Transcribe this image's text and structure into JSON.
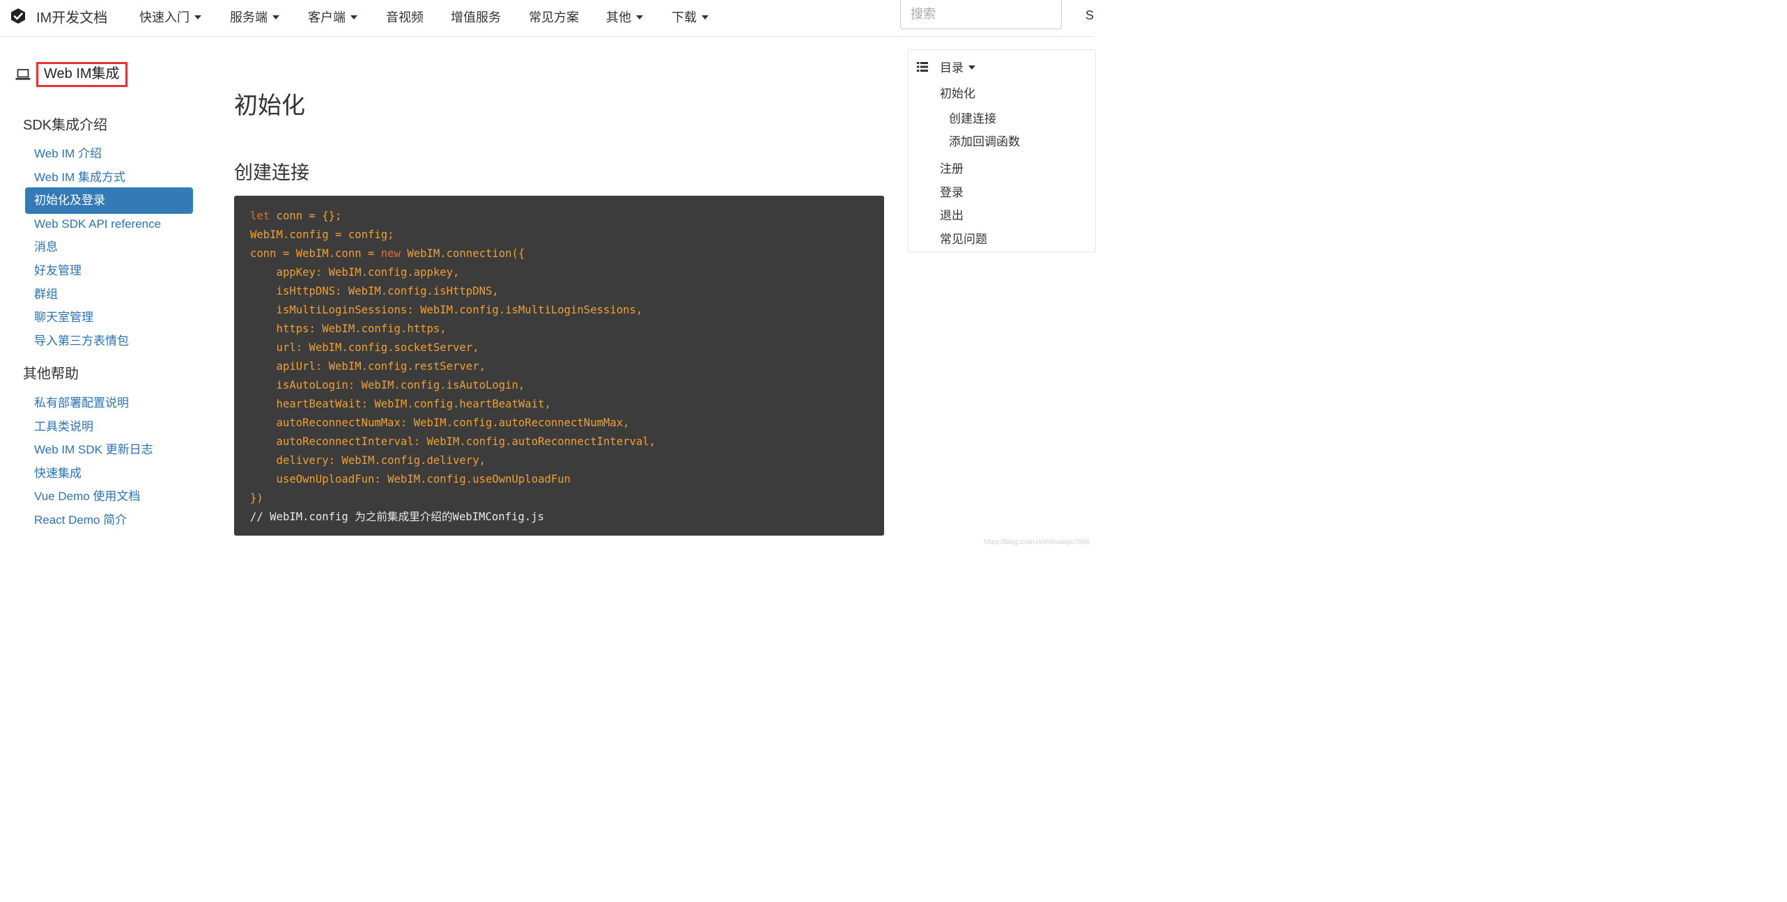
{
  "navbar": {
    "brand": "IM开发文档",
    "items": [
      {
        "label": "快速入门",
        "dropdown": true
      },
      {
        "label": "服务端",
        "dropdown": true
      },
      {
        "label": "客户端",
        "dropdown": true
      },
      {
        "label": "音视频",
        "dropdown": false
      },
      {
        "label": "增值服务",
        "dropdown": false
      },
      {
        "label": "常见方案",
        "dropdown": false
      },
      {
        "label": "其他",
        "dropdown": true
      },
      {
        "label": "下载",
        "dropdown": true
      }
    ],
    "search_placeholder": "搜索",
    "edge_glyph": "S"
  },
  "sidebar": {
    "title": "Web IM集成",
    "sections": [
      {
        "title": "SDK集成介绍",
        "items": [
          {
            "label": "Web IM 介绍",
            "active": false
          },
          {
            "label": "Web IM 集成方式",
            "active": false
          },
          {
            "label": "初始化及登录",
            "active": true
          },
          {
            "label": "Web SDK API reference",
            "active": false
          },
          {
            "label": "消息",
            "active": false
          },
          {
            "label": "好友管理",
            "active": false
          },
          {
            "label": "群组",
            "active": false
          },
          {
            "label": "聊天室管理",
            "active": false
          },
          {
            "label": "导入第三方表情包",
            "active": false
          }
        ]
      },
      {
        "title": "其他帮助",
        "items": [
          {
            "label": "私有部署配置说明",
            "active": false
          },
          {
            "label": "工具类说明",
            "active": false
          },
          {
            "label": "Web IM SDK 更新日志",
            "active": false
          },
          {
            "label": "快速集成",
            "active": false
          },
          {
            "label": "Vue Demo 使用文档",
            "active": false
          },
          {
            "label": "React Demo 简介",
            "active": false
          }
        ]
      }
    ]
  },
  "main": {
    "title": "初始化",
    "section_heading": "创建连接",
    "code": [
      [
        {
          "t": "let",
          "k": "kw"
        },
        {
          "t": " conn = {};"
        }
      ],
      [
        {
          "t": "WebIM.config = config;"
        }
      ],
      [
        {
          "t": "conn = WebIM.conn = "
        },
        {
          "t": "new",
          "k": "kw"
        },
        {
          "t": " WebIM.connection({"
        }
      ],
      [
        {
          "t": "    appKey: WebIM.config.appkey,"
        }
      ],
      [
        {
          "t": "    isHttpDNS: WebIM.config.isHttpDNS,"
        }
      ],
      [
        {
          "t": "    isMultiLoginSessions: WebIM.config.isMultiLoginSessions,"
        }
      ],
      [
        {
          "t": "    https: WebIM.config.https,"
        }
      ],
      [
        {
          "t": "    url: WebIM.config.socketServer,"
        }
      ],
      [
        {
          "t": "    apiUrl: WebIM.config.restServer,"
        }
      ],
      [
        {
          "t": "    isAutoLogin: WebIM.config.isAutoLogin,"
        }
      ],
      [
        {
          "t": "    heartBeatWait: WebIM.config.heartBeatWait,"
        }
      ],
      [
        {
          "t": "    autoReconnectNumMax: WebIM.config.autoReconnectNumMax,"
        }
      ],
      [
        {
          "t": "    autoReconnectInterval: WebIM.config.autoReconnectInterval,"
        }
      ],
      [
        {
          "t": "    delivery: WebIM.config.delivery,"
        }
      ],
      [
        {
          "t": "    useOwnUploadFun: WebIM.config.useOwnUploadFun"
        }
      ],
      [
        {
          "t": "})"
        }
      ],
      [
        {
          "t": "// WebIM.config 为之前集成里介绍的WebIMConfig.js",
          "k": "cm"
        }
      ]
    ]
  },
  "toc": {
    "header": "目录",
    "items": [
      {
        "label": "初始化",
        "level": 1
      },
      {
        "label": "创建连接",
        "level": 2
      },
      {
        "label": "添加回调函数",
        "level": 2
      },
      {
        "label": "注册",
        "level": 1
      },
      {
        "label": "登录",
        "level": 1
      },
      {
        "label": "退出",
        "level": 1
      },
      {
        "label": "常见问题",
        "level": 1
      }
    ]
  },
  "watermark": "https://blog.csdn.net/shuaiqin7986",
  "colors": {
    "link": "#2a73b8",
    "active_bg": "#337ab7",
    "code_bg": "#3c3c3c",
    "code_text": "#f0a030",
    "code_keyword": "#ea6a2e",
    "highlight_border": "#e53333"
  }
}
